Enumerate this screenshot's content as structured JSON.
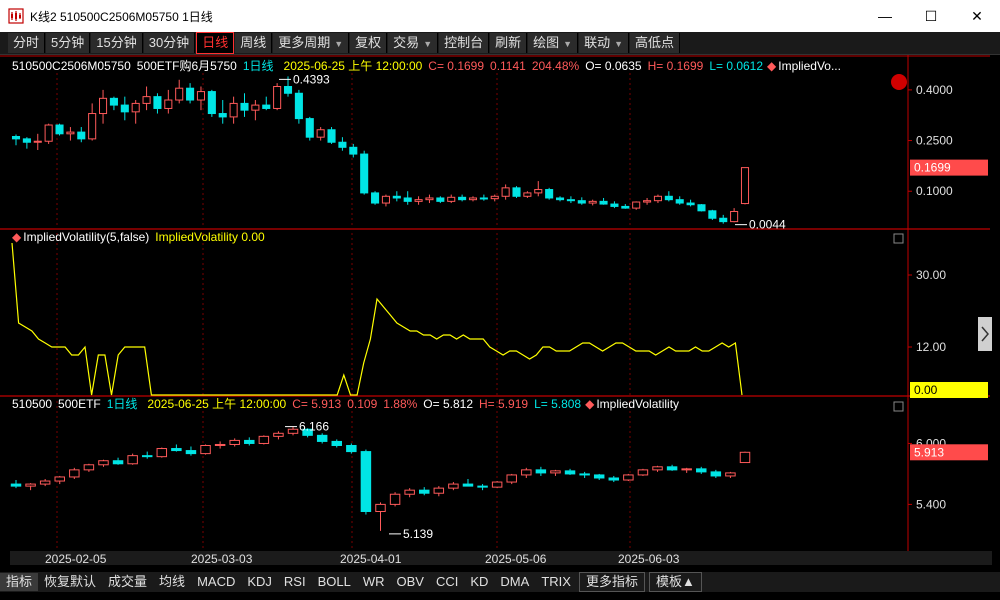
{
  "window": {
    "title": "K线2 510500C2506M05750 1日线",
    "minimize": "—",
    "maximize": "☐",
    "close": "✕"
  },
  "toolbar": [
    {
      "label": "分时",
      "active": false,
      "caret": false
    },
    {
      "label": "5分钟",
      "active": false,
      "caret": false
    },
    {
      "label": "15分钟",
      "active": false,
      "caret": false
    },
    {
      "label": "30分钟",
      "active": false,
      "caret": false
    },
    {
      "label": "日线",
      "active": true,
      "caret": false
    },
    {
      "label": "周线",
      "active": false,
      "caret": false
    },
    {
      "label": "更多周期",
      "active": false,
      "caret": true
    },
    {
      "label": "复权",
      "active": false,
      "caret": false
    },
    {
      "label": "交易",
      "active": false,
      "caret": true
    },
    {
      "label": "控制台",
      "active": false,
      "caret": false
    },
    {
      "label": "刷新",
      "active": false,
      "caret": false
    },
    {
      "label": "绘图",
      "active": false,
      "caret": true
    },
    {
      "label": "联动",
      "active": false,
      "caret": true
    },
    {
      "label": "高低点",
      "active": false,
      "caret": false
    }
  ],
  "panel1": {
    "code": "510500C2506M05750",
    "name": "500ETF购6月5750",
    "period": "1日线",
    "datetime": "2025-06-25 上午 12:00:00",
    "close": "C= 0.1699",
    "change": "0.1141",
    "pct": "204.48%",
    "open": "O= 0.0635",
    "high": "H= 0.1699",
    "low": "L= 0.0612",
    "indicator": "ImpliedVo...",
    "axis": [
      "0.4000",
      "0.2500",
      "0.1000"
    ],
    "last_badge": "0.1699",
    "max_label": "0.4393",
    "min_label": "0.0044"
  },
  "panel2": {
    "indicator": "ImpliedVolatility(5,false)",
    "value": "ImpliedVolatility 0.00",
    "axis": [
      "30.00",
      "12.00"
    ],
    "last_badge": "0.00"
  },
  "panel3": {
    "code": "510500",
    "name": "500ETF",
    "period": "1日线",
    "datetime": "2025-06-25 上午 12:00:00",
    "close": "C= 5.913",
    "change": "0.109",
    "pct": "1.88%",
    "open": "O= 5.812",
    "high": "H= 5.919",
    "low": "L= 5.808",
    "indicator": "ImpliedVolatility",
    "axis": [
      "6.000",
      "5.400"
    ],
    "last_badge": "5.913",
    "max_label": "6.166",
    "min_label": "5.139"
  },
  "x_axis": [
    "2025-02-05",
    "2025-03-03",
    "2025-04-01",
    "2025-05-06",
    "2025-06-03"
  ],
  "bottom_tabs": [
    {
      "label": "指标",
      "active": true,
      "sep": false
    },
    {
      "label": "恢复默认",
      "active": false,
      "sep": false
    },
    {
      "label": "成交量",
      "active": false,
      "sep": false
    },
    {
      "label": "均线",
      "active": false,
      "sep": false
    },
    {
      "label": "MACD",
      "active": false,
      "sep": false
    },
    {
      "label": "KDJ",
      "active": false,
      "sep": false
    },
    {
      "label": "RSI",
      "active": false,
      "sep": false
    },
    {
      "label": "BOLL",
      "active": false,
      "sep": false
    },
    {
      "label": "WR",
      "active": false,
      "sep": false
    },
    {
      "label": "OBV",
      "active": false,
      "sep": false
    },
    {
      "label": "CCI",
      "active": false,
      "sep": false
    },
    {
      "label": "KD",
      "active": false,
      "sep": false
    },
    {
      "label": "DMA",
      "active": false,
      "sep": false
    },
    {
      "label": "TRIX",
      "active": false,
      "sep": false
    },
    {
      "label": "更多指标",
      "active": false,
      "sep": true
    },
    {
      "label": "模板▲",
      "active": false,
      "sep": true
    }
  ],
  "colors": {
    "up": "#ff5a5a",
    "down": "#00e5e5",
    "ivline": "#ffff00",
    "divider": "#c00000",
    "grid": "#7a0000"
  },
  "chart_data": [
    {
      "type": "candlestick",
      "title": "510500C2506M05750",
      "ylim": [
        0.0,
        0.45
      ],
      "ohlc": [
        [
          0.262,
          0.268,
          0.236,
          0.255
        ],
        [
          0.255,
          0.26,
          0.226,
          0.245
        ],
        [
          0.245,
          0.27,
          0.222,
          0.248
        ],
        [
          0.248,
          0.3,
          0.24,
          0.296
        ],
        [
          0.296,
          0.3,
          0.265,
          0.27
        ],
        [
          0.27,
          0.29,
          0.25,
          0.275
        ],
        [
          0.275,
          0.29,
          0.245,
          0.255
        ],
        [
          0.255,
          0.36,
          0.25,
          0.33
        ],
        [
          0.33,
          0.4,
          0.3,
          0.375
        ],
        [
          0.375,
          0.38,
          0.34,
          0.355
        ],
        [
          0.355,
          0.38,
          0.31,
          0.335
        ],
        [
          0.335,
          0.37,
          0.3,
          0.36
        ],
        [
          0.36,
          0.41,
          0.34,
          0.38
        ],
        [
          0.38,
          0.39,
          0.33,
          0.345
        ],
        [
          0.345,
          0.4,
          0.33,
          0.37
        ],
        [
          0.37,
          0.43,
          0.36,
          0.405
        ],
        [
          0.405,
          0.42,
          0.36,
          0.37
        ],
        [
          0.37,
          0.41,
          0.34,
          0.395
        ],
        [
          0.395,
          0.4,
          0.32,
          0.33
        ],
        [
          0.33,
          0.37,
          0.3,
          0.32
        ],
        [
          0.32,
          0.38,
          0.3,
          0.36
        ],
        [
          0.36,
          0.39,
          0.32,
          0.34
        ],
        [
          0.34,
          0.37,
          0.31,
          0.355
        ],
        [
          0.355,
          0.38,
          0.34,
          0.345
        ],
        [
          0.345,
          0.42,
          0.34,
          0.41
        ],
        [
          0.41,
          0.44,
          0.38,
          0.39
        ],
        [
          0.39,
          0.4,
          0.3,
          0.315
        ],
        [
          0.315,
          0.32,
          0.25,
          0.26
        ],
        [
          0.26,
          0.29,
          0.25,
          0.282
        ],
        [
          0.282,
          0.29,
          0.24,
          0.245
        ],
        [
          0.245,
          0.26,
          0.22,
          0.23
        ],
        [
          0.23,
          0.24,
          0.2,
          0.21
        ],
        [
          0.21,
          0.22,
          0.09,
          0.095
        ],
        [
          0.095,
          0.1,
          0.06,
          0.065
        ],
        [
          0.065,
          0.09,
          0.055,
          0.085
        ],
        [
          0.085,
          0.1,
          0.07,
          0.08
        ],
        [
          0.08,
          0.1,
          0.06,
          0.07
        ],
        [
          0.07,
          0.085,
          0.06,
          0.075
        ],
        [
          0.075,
          0.09,
          0.065,
          0.08
        ],
        [
          0.08,
          0.085,
          0.065,
          0.07
        ],
        [
          0.07,
          0.09,
          0.065,
          0.082
        ],
        [
          0.082,
          0.09,
          0.07,
          0.075
        ],
        [
          0.075,
          0.085,
          0.07,
          0.08
        ],
        [
          0.08,
          0.09,
          0.072,
          0.078
        ],
        [
          0.078,
          0.09,
          0.07,
          0.085
        ],
        [
          0.085,
          0.12,
          0.075,
          0.11
        ],
        [
          0.11,
          0.115,
          0.08,
          0.085
        ],
        [
          0.085,
          0.1,
          0.08,
          0.095
        ],
        [
          0.095,
          0.13,
          0.085,
          0.105
        ],
        [
          0.105,
          0.11,
          0.075,
          0.08
        ],
        [
          0.08,
          0.085,
          0.07,
          0.075
        ],
        [
          0.075,
          0.085,
          0.065,
          0.072
        ],
        [
          0.072,
          0.082,
          0.06,
          0.065
        ],
        [
          0.065,
          0.075,
          0.058,
          0.07
        ],
        [
          0.07,
          0.08,
          0.06,
          0.062
        ],
        [
          0.062,
          0.07,
          0.05,
          0.055
        ],
        [
          0.055,
          0.062,
          0.048,
          0.05
        ],
        [
          0.05,
          0.07,
          0.045,
          0.068
        ],
        [
          0.068,
          0.08,
          0.06,
          0.072
        ],
        [
          0.072,
          0.09,
          0.065,
          0.085
        ],
        [
          0.085,
          0.1,
          0.07,
          0.075
        ],
        [
          0.075,
          0.085,
          0.06,
          0.065
        ],
        [
          0.065,
          0.075,
          0.055,
          0.06
        ],
        [
          0.06,
          0.062,
          0.04,
          0.042
        ],
        [
          0.042,
          0.045,
          0.015,
          0.02
        ],
        [
          0.02,
          0.03,
          0.004,
          0.01
        ],
        [
          0.01,
          0.05,
          0.008,
          0.04
        ],
        [
          0.0635,
          0.1699,
          0.0612,
          0.1699
        ]
      ]
    },
    {
      "type": "line",
      "title": "ImpliedVolatility(5,false)",
      "ylim": [
        0,
        38
      ],
      "values": [
        38,
        18,
        17,
        16,
        14,
        13,
        12,
        12,
        12,
        10,
        10,
        12,
        0,
        10,
        10,
        0,
        10,
        12,
        12,
        12,
        12,
        0,
        0,
        0,
        0,
        0,
        0,
        0,
        0,
        0,
        0,
        0,
        0,
        0,
        0,
        0,
        0,
        0,
        0,
        0,
        0,
        0,
        0,
        0,
        0,
        0,
        0,
        0,
        0,
        0,
        5,
        0,
        0,
        8,
        14,
        24,
        22,
        20,
        18,
        17,
        16,
        16,
        15,
        15,
        14,
        15,
        15,
        14,
        15,
        14,
        14,
        14,
        12,
        11,
        10,
        11,
        11,
        10,
        9,
        10,
        12,
        12,
        11,
        11,
        11,
        12,
        13,
        13,
        12,
        11,
        12,
        13,
        13,
        12,
        11,
        11,
        11,
        10,
        11,
        12,
        11,
        11,
        11,
        12,
        11,
        11,
        12,
        13,
        12,
        13,
        0
      ]
    },
    {
      "type": "candlestick",
      "title": "510500",
      "ylim": [
        5.0,
        6.3
      ],
      "ohlc": [
        [
          5.6,
          5.64,
          5.56,
          5.58
        ],
        [
          5.58,
          5.61,
          5.54,
          5.6
        ],
        [
          5.6,
          5.65,
          5.58,
          5.63
        ],
        [
          5.63,
          5.68,
          5.6,
          5.67
        ],
        [
          5.67,
          5.76,
          5.65,
          5.74
        ],
        [
          5.74,
          5.8,
          5.72,
          5.79
        ],
        [
          5.79,
          5.84,
          5.77,
          5.83
        ],
        [
          5.83,
          5.86,
          5.79,
          5.8
        ],
        [
          5.8,
          5.9,
          5.79,
          5.88
        ],
        [
          5.88,
          5.92,
          5.85,
          5.87
        ],
        [
          5.87,
          5.96,
          5.86,
          5.95
        ],
        [
          5.95,
          5.99,
          5.92,
          5.93
        ],
        [
          5.93,
          5.97,
          5.88,
          5.9
        ],
        [
          5.9,
          5.99,
          5.89,
          5.98
        ],
        [
          5.98,
          6.02,
          5.95,
          5.99
        ],
        [
          5.99,
          6.05,
          5.97,
          6.03
        ],
        [
          6.03,
          6.06,
          5.98,
          6.0
        ],
        [
          6.0,
          6.08,
          5.99,
          6.07
        ],
        [
          6.07,
          6.12,
          6.04,
          6.1
        ],
        [
          6.1,
          6.166,
          6.08,
          6.14
        ],
        [
          6.14,
          6.15,
          6.06,
          6.08
        ],
        [
          6.08,
          6.1,
          6.0,
          6.02
        ],
        [
          6.02,
          6.04,
          5.96,
          5.98
        ],
        [
          5.98,
          6.0,
          5.9,
          5.92
        ],
        [
          5.92,
          5.94,
          5.3,
          5.33
        ],
        [
          5.33,
          5.42,
          5.139,
          5.4
        ],
        [
          5.4,
          5.52,
          5.38,
          5.5
        ],
        [
          5.5,
          5.56,
          5.47,
          5.54
        ],
        [
          5.54,
          5.57,
          5.49,
          5.51
        ],
        [
          5.51,
          5.58,
          5.48,
          5.56
        ],
        [
          5.56,
          5.62,
          5.54,
          5.6
        ],
        [
          5.6,
          5.65,
          5.58,
          5.58
        ],
        [
          5.58,
          5.6,
          5.54,
          5.57
        ],
        [
          5.57,
          5.63,
          5.56,
          5.62
        ],
        [
          5.62,
          5.7,
          5.6,
          5.69
        ],
        [
          5.69,
          5.76,
          5.66,
          5.74
        ],
        [
          5.74,
          5.77,
          5.68,
          5.71
        ],
        [
          5.71,
          5.74,
          5.68,
          5.73
        ],
        [
          5.73,
          5.75,
          5.69,
          5.7
        ],
        [
          5.7,
          5.72,
          5.66,
          5.69
        ],
        [
          5.69,
          5.7,
          5.64,
          5.66
        ],
        [
          5.66,
          5.68,
          5.62,
          5.64
        ],
        [
          5.64,
          5.7,
          5.63,
          5.69
        ],
        [
          5.69,
          5.75,
          5.68,
          5.74
        ],
        [
          5.74,
          5.78,
          5.72,
          5.77
        ],
        [
          5.77,
          5.79,
          5.73,
          5.74
        ],
        [
          5.74,
          5.76,
          5.71,
          5.75
        ],
        [
          5.75,
          5.77,
          5.7,
          5.72
        ],
        [
          5.72,
          5.74,
          5.66,
          5.68
        ],
        [
          5.68,
          5.72,
          5.66,
          5.71
        ],
        [
          5.812,
          5.919,
          5.808,
          5.913
        ]
      ]
    }
  ]
}
